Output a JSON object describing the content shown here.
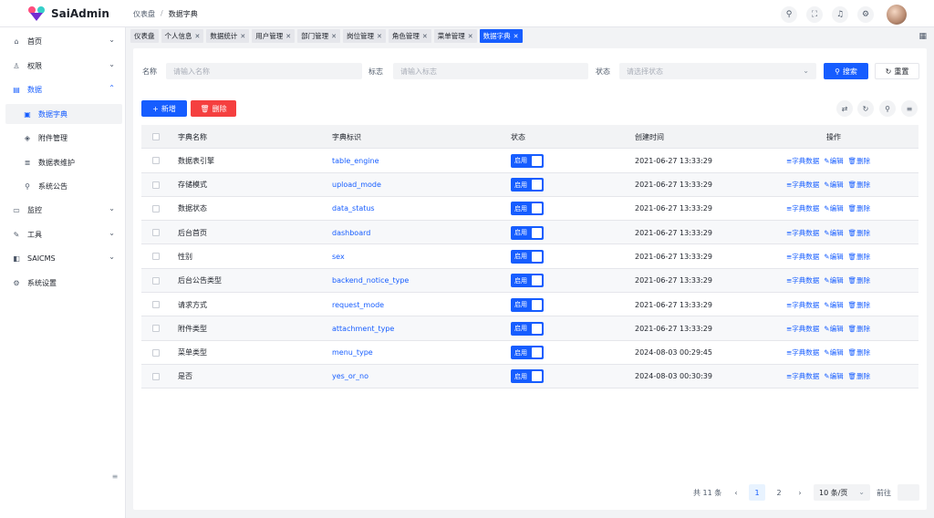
{
  "app": {
    "name": "SaiAdmin"
  },
  "breadcrumb": {
    "home": "仪表盘",
    "sep": "/",
    "current": "数据字典"
  },
  "top_icons": [
    "search-icon",
    "fullscreen-icon",
    "bell-icon",
    "settings-icon"
  ],
  "sidebar": {
    "items": [
      {
        "label": "首页",
        "icon": "⌂",
        "chev": "⌄"
      },
      {
        "label": "权限",
        "icon": "♙",
        "chev": "⌄"
      },
      {
        "label": "数据",
        "icon": "▤",
        "chev": "⌃"
      },
      {
        "label": "数据字典",
        "icon": "▣"
      },
      {
        "label": "附件管理",
        "icon": "◈"
      },
      {
        "label": "数据表维护",
        "icon": "≣"
      },
      {
        "label": "系统公告",
        "icon": "⚲"
      },
      {
        "label": "监控",
        "icon": "▭",
        "chev": "⌄"
      },
      {
        "label": "工具",
        "icon": "✎",
        "chev": "⌄"
      },
      {
        "label": "SAICMS",
        "icon": "◧",
        "chev": "⌄"
      },
      {
        "label": "系统设置",
        "icon": "⚙"
      }
    ],
    "collapse": "≡"
  },
  "tabs": [
    {
      "label": "仪表盘",
      "closable": false
    },
    {
      "label": "个人信息",
      "closable": true
    },
    {
      "label": "数据统计",
      "closable": true
    },
    {
      "label": "用户管理",
      "closable": true
    },
    {
      "label": "部门管理",
      "closable": true
    },
    {
      "label": "岗位管理",
      "closable": true
    },
    {
      "label": "角色管理",
      "closable": true
    },
    {
      "label": "菜单管理",
      "closable": true
    },
    {
      "label": "数据字典",
      "closable": true,
      "active": true
    }
  ],
  "filters": {
    "name_label": "名称",
    "name_placeholder": "请输入名称",
    "code_label": "标志",
    "code_placeholder": "请输入标志",
    "status_label": "状态",
    "status_placeholder": "请选择状态",
    "search_label": "搜索",
    "reset_label": "重置"
  },
  "toolbar": {
    "add_label": "新增",
    "delete_label": "删除"
  },
  "table": {
    "columns": [
      "字典名称",
      "字典标识",
      "状态",
      "创建时间",
      "操作"
    ],
    "rows": [
      {
        "name": "数据表引擎",
        "code": "table_engine",
        "status": "启用",
        "created": "2021-06-27 13:33:29"
      },
      {
        "name": "存储模式",
        "code": "upload_mode",
        "status": "启用",
        "created": "2021-06-27 13:33:29"
      },
      {
        "name": "数据状态",
        "code": "data_status",
        "status": "启用",
        "created": "2021-06-27 13:33:29"
      },
      {
        "name": "后台首页",
        "code": "dashboard",
        "status": "启用",
        "created": "2021-06-27 13:33:29"
      },
      {
        "name": "性别",
        "code": "sex",
        "status": "启用",
        "created": "2021-06-27 13:33:29"
      },
      {
        "name": "后台公告类型",
        "code": "backend_notice_type",
        "status": "启用",
        "created": "2021-06-27 13:33:29"
      },
      {
        "name": "请求方式",
        "code": "request_mode",
        "status": "启用",
        "created": "2021-06-27 13:33:29"
      },
      {
        "name": "附件类型",
        "code": "attachment_type",
        "status": "启用",
        "created": "2021-06-27 13:33:29"
      },
      {
        "name": "菜单类型",
        "code": "menu_type",
        "status": "启用",
        "created": "2024-08-03 00:29:45"
      },
      {
        "name": "是否",
        "code": "yes_or_no",
        "status": "启用",
        "created": "2024-08-03 00:30:39"
      }
    ],
    "actions": {
      "data": "≡字典数据",
      "edit": "✎编辑",
      "delete": "🗑删除"
    }
  },
  "pagination": {
    "total": "共 11 条",
    "pages": [
      "1",
      "2"
    ],
    "current": "1",
    "page_size": "10 条/页",
    "goto_label": "前往"
  },
  "colors": {
    "primary": "#165dff",
    "danger": "#f53f3f",
    "bg": "#f2f3f5"
  }
}
